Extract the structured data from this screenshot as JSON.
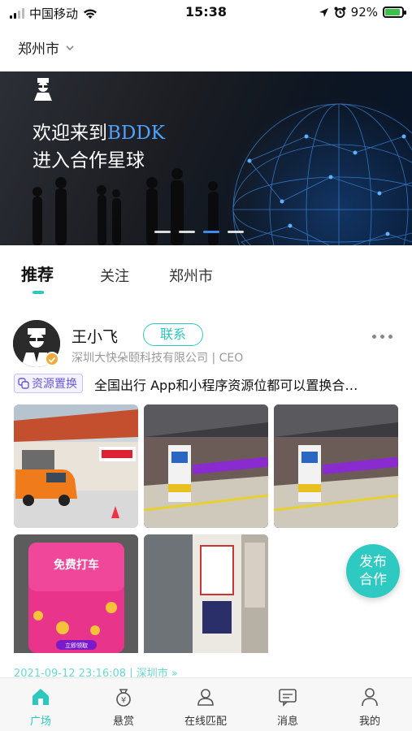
{
  "status_bar": {
    "carrier": "中国移动",
    "time": "15:38",
    "battery": "92%",
    "battery_level": 0.92
  },
  "city_selector": {
    "label": "郑州市",
    "icon": "chevron-down-icon"
  },
  "banner": {
    "line1_prefix": "欢迎来到",
    "line1_brand": "BDDK",
    "line2": "进入合作星球",
    "page_count": 4,
    "active_page": 3,
    "brand_color": "#4fa3ff"
  },
  "tabs": [
    {
      "label": "推荐",
      "active": true
    },
    {
      "label": "关注",
      "active": false
    },
    {
      "label": "郑州市",
      "active": false
    }
  ],
  "post": {
    "user_name": "王小飞",
    "contact_label": "联系",
    "company": "深圳大快朵颐科技有限公司 | CEO",
    "tag": "资源置换",
    "text": "全国出行 App和小程序资源位都可以置换合…",
    "meta": "2021-09-12 23:16:08 | 深圳市  »",
    "images": [
      {
        "desc": "storefront-with-orange-van"
      },
      {
        "desc": "ev-charging-station-night"
      },
      {
        "desc": "ev-charging-station-night"
      },
      {
        "desc": "free-taxi-promo-poster",
        "poster_title": "免费打车",
        "poster_button": "立即领取"
      },
      {
        "desc": "store-entrance-poster"
      }
    ]
  },
  "fab": {
    "line1": "发布",
    "line2": "合作"
  },
  "bottom_nav": [
    {
      "label": "广场",
      "icon": "home-icon",
      "active": true
    },
    {
      "label": "悬赏",
      "icon": "money-bag-icon",
      "active": false
    },
    {
      "label": "在线匹配",
      "icon": "match-icon",
      "active": false
    },
    {
      "label": "消息",
      "icon": "message-icon",
      "active": false
    },
    {
      "label": "我的",
      "icon": "profile-icon",
      "active": false
    }
  ],
  "colors": {
    "accent": "#2cc8c0",
    "tag_purple": "#6a5acd",
    "verify_badge": "#f2a93b"
  }
}
